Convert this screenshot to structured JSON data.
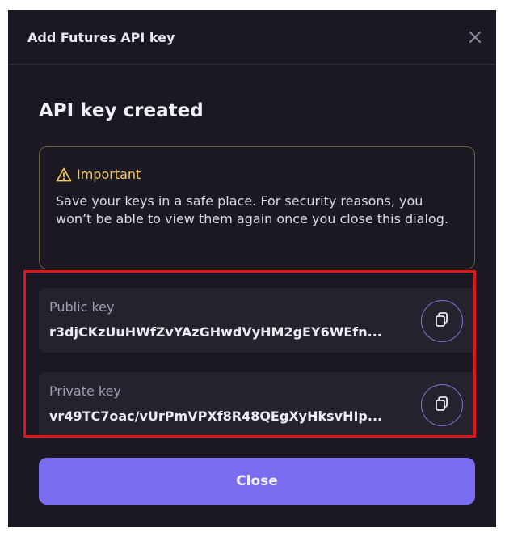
{
  "dialog": {
    "title": "Add Futures API key",
    "close_icon": "close-icon",
    "heading": "API key created"
  },
  "notice": {
    "icon": "warning-icon",
    "title": "Important",
    "body": "Save your keys in a safe place. For security reasons, you won’t be able to view them again once you close this dialog."
  },
  "keys": [
    {
      "label": "Public key",
      "value": "r3djCKzUuHWfZvYAzGHwdVyHM2gEY6WEfn...",
      "copy_icon": "copy-icon"
    },
    {
      "label": "Private key",
      "value": "vr49TC7oac/vUrPmVPXf8R48QEgXyHksvHIp...",
      "copy_icon": "copy-icon"
    }
  ],
  "actions": {
    "close_label": "Close"
  },
  "colors": {
    "dialog_background": "#1b1823",
    "accent": "#7b6df0",
    "warning": "#f0c95a",
    "highlight_annotation": "#e0141b"
  }
}
